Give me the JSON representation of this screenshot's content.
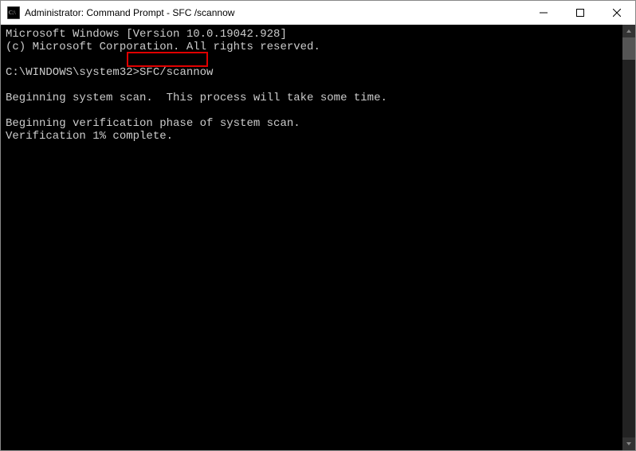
{
  "window": {
    "title": "Administrator: Command Prompt - SFC /scannow"
  },
  "terminal": {
    "line_version": "Microsoft Windows [Version 10.0.19042.928]",
    "line_copyright": "(c) Microsoft Corporation. All rights reserved.",
    "prompt": "C:\\WINDOWS\\system32>",
    "command": "SFC/scannow",
    "line_scan_begin": "Beginning system scan.  This process will take some time.",
    "line_verify": "Beginning verification phase of system scan.",
    "line_progress": "Verification 1% complete."
  }
}
